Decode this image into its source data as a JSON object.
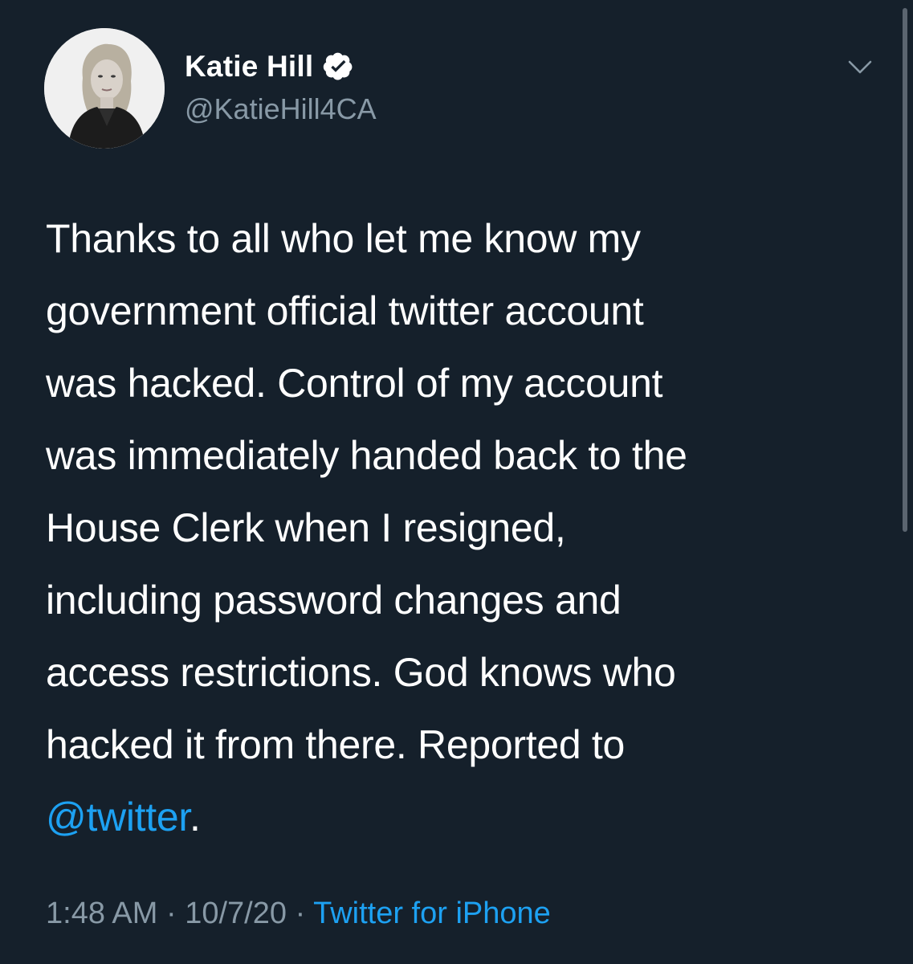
{
  "tweet": {
    "author": {
      "display_name": "Katie Hill",
      "handle": "@KatieHill4CA",
      "verified": true
    },
    "text_lines": [
      "Thanks to all who let me know my",
      "government official twitter account",
      "was hacked. Control of my account",
      "was immediately handed back to the",
      "House Clerk when I resigned,",
      "including password changes and",
      "access restrictions. God knows who",
      "hacked it from there. Reported to"
    ],
    "mention": "@twitter",
    "trailing_punct": ".",
    "time": "1:48 AM",
    "date": "10/7/20",
    "separator": "·",
    "source": "Twitter for iPhone"
  },
  "colors": {
    "background": "#15202b",
    "text": "#ffffff",
    "secondary": "#8899a6",
    "accent": "#1da1f2"
  },
  "icons": {
    "verified": "verified-badge-icon",
    "menu": "chevron-down-icon"
  }
}
